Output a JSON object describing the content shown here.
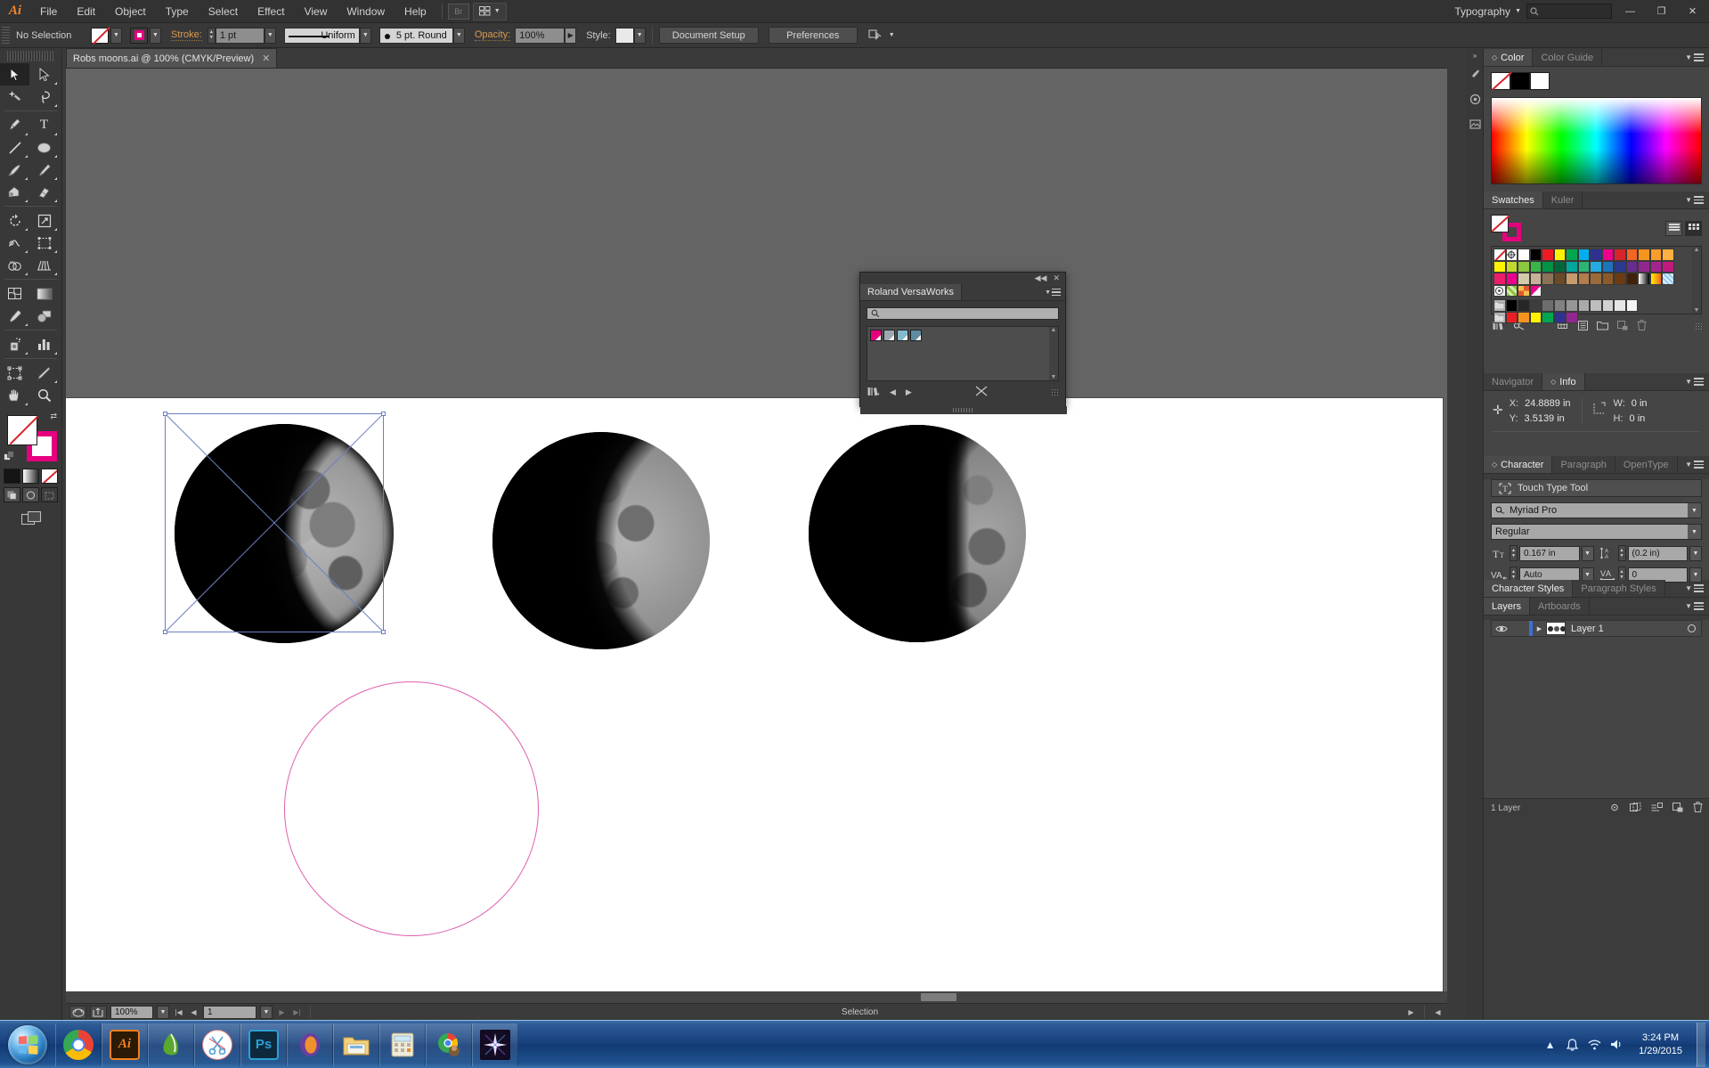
{
  "app": {
    "logo": "Ai",
    "menus": [
      "File",
      "Edit",
      "Object",
      "Type",
      "Select",
      "Effect",
      "View",
      "Window",
      "Help"
    ],
    "bridge_label": "Br",
    "workspace_label": "Typography",
    "search_placeholder": "",
    "window_buttons": {
      "minimize": "—",
      "restore": "❐",
      "close": "✕"
    }
  },
  "control_bar": {
    "selection_state": "No Selection",
    "fill_label": "fill-none",
    "stroke_label": "stroke-magenta",
    "stroke_text": "Stroke:",
    "stroke_weight": "1 pt",
    "stroke_profile": "Uniform",
    "brush_definition": "5 pt. Round",
    "opacity_text": "Opacity:",
    "opacity_value": "100%",
    "style_text": "Style:",
    "document_setup": "Document Setup",
    "preferences": "Preferences",
    "align_label": "align-to"
  },
  "document": {
    "tab_title": "Robs moons.ai @ 100% (CMYK/Preview)",
    "close_glyph": "✕"
  },
  "tools": [
    {
      "name": "selection-tool",
      "active": true
    },
    {
      "name": "direct-selection-tool",
      "active": false
    },
    {
      "name": "magic-wand-tool",
      "active": false
    },
    {
      "name": "lasso-tool",
      "active": false
    },
    {
      "name": "pen-tool",
      "active": false
    },
    {
      "name": "type-tool",
      "active": false
    },
    {
      "name": "line-segment-tool",
      "active": false
    },
    {
      "name": "ellipse-tool",
      "active": false
    },
    {
      "name": "paintbrush-tool",
      "active": false
    },
    {
      "name": "pencil-tool",
      "active": false
    },
    {
      "name": "blob-brush-tool",
      "active": false
    },
    {
      "name": "eraser-tool",
      "active": false
    },
    {
      "name": "rotate-tool",
      "active": false
    },
    {
      "name": "scale-tool",
      "active": false
    },
    {
      "name": "width-tool",
      "active": false
    },
    {
      "name": "free-transform-tool",
      "active": false
    },
    {
      "name": "shape-builder-tool",
      "active": false
    },
    {
      "name": "perspective-grid-tool",
      "active": false
    },
    {
      "name": "mesh-tool",
      "active": false
    },
    {
      "name": "gradient-tool",
      "active": false
    },
    {
      "name": "eyedropper-tool",
      "active": false
    },
    {
      "name": "blend-tool",
      "active": false
    },
    {
      "name": "symbol-sprayer-tool",
      "active": false
    },
    {
      "name": "column-graph-tool",
      "active": false
    },
    {
      "name": "artboard-tool",
      "active": false
    },
    {
      "name": "slice-tool",
      "active": false
    },
    {
      "name": "hand-tool",
      "active": false
    },
    {
      "name": "zoom-tool",
      "active": false
    }
  ],
  "versaworks_panel": {
    "title": "Roland VersaWorks",
    "search_placeholder": "",
    "swatches": [
      "#e6007e",
      "#9fa8b0",
      "#84b8cc",
      "#5e8c9e"
    ],
    "collapse_glyph": "◀◀",
    "close_glyph": "✕"
  },
  "panels": {
    "color": {
      "tabs": [
        "Color",
        "Color Guide"
      ],
      "selected": "Color",
      "swatches": [
        "none",
        "#000000",
        "#ffffff"
      ]
    },
    "swatches": {
      "tabs": [
        "Swatches",
        "Kuler"
      ],
      "selected": "Swatches",
      "rows": [
        [
          "none",
          "registration",
          "#ffffff",
          "#000000",
          "#ed1c24",
          "#fff200",
          "#00a651",
          "#00aeef",
          "#2e3192",
          "#ec008c",
          "#ed1c24",
          "#f26522",
          "#f7941e",
          "#f7941e",
          "#fbb040"
        ],
        [
          "#fff200",
          "#c3d82e",
          "#8dc63f",
          "#39b54a",
          "#009444",
          "#006838",
          "#00a79d",
          "#2bb673",
          "#27aae1",
          "#1c75bc",
          "#2b3990",
          "#662d91",
          "#92278f",
          "#a4248f",
          "#c1197f"
        ],
        [
          "#ed1c69",
          "#ec008c",
          "#d4c9a8",
          "#c7b299",
          "#a67c52",
          "#754c24",
          "#c69c6d",
          "#b07d4b",
          "#8c6239",
          "#754c24",
          "#603813",
          "#42210b",
          "#gradient-bw",
          "#gradient-yo",
          "#gradient-blue"
        ],
        [
          "#pattern-dots",
          "#pattern-leaf",
          "#pattern-confetti",
          "#pattern-diag"
        ],
        [
          "#folder",
          "#000000",
          "#2b2b2b",
          "#3d3d3d",
          "#6d6d6d",
          "#828282",
          "#969696",
          "#aaaaaa",
          "#bebebe",
          "#d2d2d2",
          "#e6e6e6",
          "#f5f5f5"
        ],
        [
          "#folder2",
          "#ed1c24",
          "#f7941e",
          "#fff200",
          "#00a651",
          "#2e3192",
          "#92278f"
        ]
      ],
      "view_list": "list-view",
      "view_grid": "grid-view"
    },
    "info": {
      "tabs": [
        "Navigator",
        "Info"
      ],
      "selected": "Info",
      "x_label": "X:",
      "x_value": "24.8889 in",
      "y_label": "Y:",
      "y_value": "3.5139 in",
      "w_label": "W:",
      "w_value": "0 in",
      "h_label": "H:",
      "h_value": "0 in"
    },
    "character": {
      "tabs": [
        "Character",
        "Paragraph",
        "OpenType"
      ],
      "selected": "Character",
      "touch_type_tool": "Touch Type Tool",
      "font_family": "Myriad Pro",
      "font_style": "Regular",
      "font_size": "0.167 in",
      "leading": "(0.2 in)",
      "kerning": "Auto",
      "tracking": "0"
    },
    "styles": {
      "tabs": [
        "Character Styles",
        "Paragraph Styles"
      ],
      "selected": "Character Styles"
    },
    "layers": {
      "tabs": [
        "Layers",
        "Artboards"
      ],
      "selected": "Layers",
      "rows": [
        {
          "name": "Layer 1",
          "visible": true,
          "selected": true
        }
      ],
      "footer_count": "1 Layer"
    }
  },
  "status_bar": {
    "zoom": "100%",
    "artboard_number": "1",
    "status_text": "Selection"
  },
  "artwork": {
    "moons": [
      {
        "name": "moon-waxing-gibbous",
        "phase": 0.78,
        "selected": true
      },
      {
        "name": "moon-first-quarter",
        "phase": 0.52,
        "selected": false
      },
      {
        "name": "moon-waxing-crescent",
        "phase": 0.3,
        "selected": false
      }
    ],
    "circle_path": {
      "name": "ellipse-path",
      "stroke": "#e060b0"
    }
  },
  "taskbar": {
    "start_label": "Start",
    "apps": [
      {
        "name": "chrome",
        "label": ""
      },
      {
        "name": "illustrator",
        "label": "Ai"
      },
      {
        "name": "coreldraw",
        "label": ""
      },
      {
        "name": "snipping-tool",
        "label": ""
      },
      {
        "name": "photoshop",
        "label": "Ps"
      },
      {
        "name": "versaworks",
        "label": ""
      },
      {
        "name": "file-explorer",
        "label": ""
      },
      {
        "name": "calculator",
        "label": ""
      },
      {
        "name": "chrome-window",
        "label": ""
      },
      {
        "name": "media-app",
        "label": ""
      }
    ],
    "clock_time": "3:24 PM",
    "clock_date": "1/29/2015"
  }
}
